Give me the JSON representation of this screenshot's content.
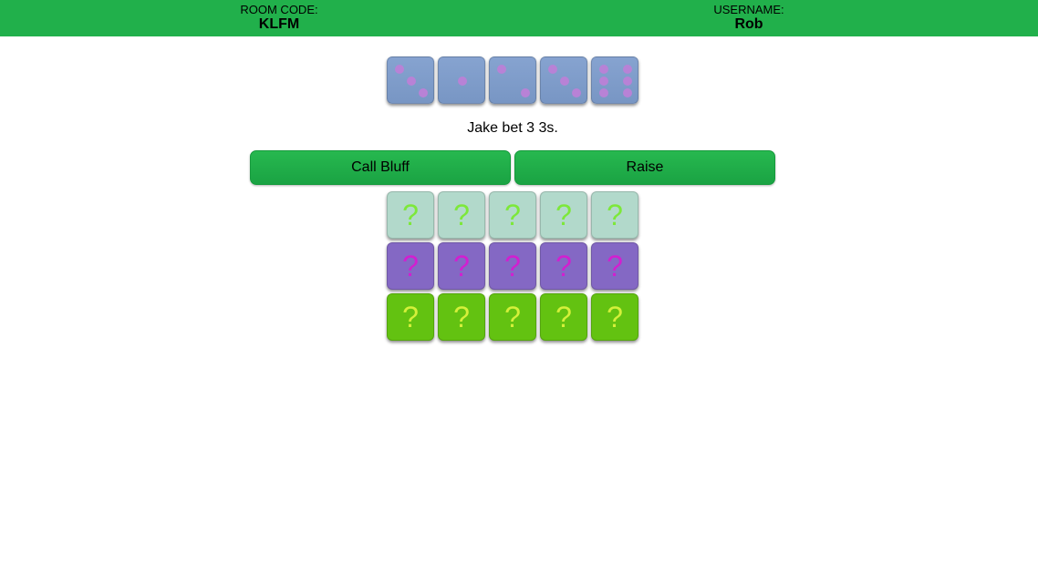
{
  "header": {
    "room_code_label": "ROOM CODE:",
    "room_code": "KLFM",
    "username_label": "USERNAME:",
    "username": "Rob"
  },
  "my_dice": [
    {
      "face": 3
    },
    {
      "face": 1
    },
    {
      "face": 2
    },
    {
      "face": 3
    },
    {
      "face": 6
    }
  ],
  "status_text": "Jake bet 3 3s.",
  "actions": {
    "call_bluff_label": "Call Bluff",
    "raise_label": "Raise"
  },
  "opponents": [
    {
      "dice": [
        "?",
        "?",
        "?",
        "?",
        "?"
      ],
      "bg": "#b2d9cb",
      "mark": "#7de83a"
    },
    {
      "dice": [
        "?",
        "?",
        "?",
        "?",
        "?"
      ],
      "bg": "#8468c4",
      "mark": "#d21fd0"
    },
    {
      "dice": [
        "?",
        "?",
        "?",
        "?",
        "?"
      ],
      "bg": "#63c211",
      "mark": "#d4f03a"
    }
  ],
  "colors": {
    "header_bg": "#21b04b",
    "button_bg": "#21b04b",
    "my_die_bg": "#7d9bc9",
    "pip": "#b882d6"
  }
}
